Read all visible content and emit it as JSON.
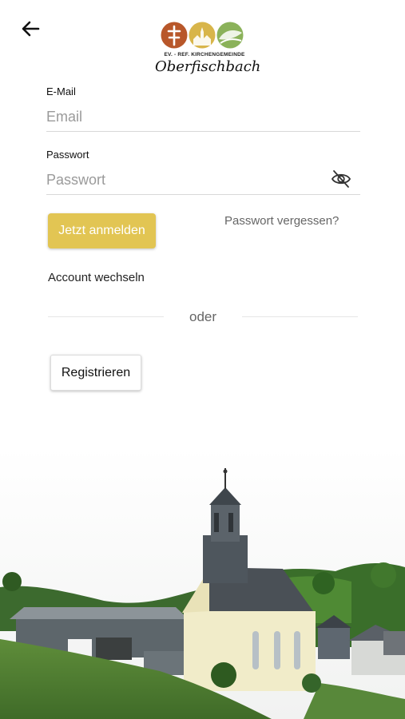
{
  "header": {
    "back_icon": "arrow-left-icon",
    "logo": {
      "subtitle": "EV. - REF. KIRCHENGEMEINDE",
      "name": "Oberfischbach",
      "colors": {
        "cross": "#b8572a",
        "church": "#d8b54a",
        "leaf": "#8bb25a"
      }
    }
  },
  "form": {
    "email": {
      "label": "E-Mail",
      "placeholder": "Email",
      "value": ""
    },
    "password": {
      "label": "Passwort",
      "placeholder": "Passwort",
      "value": "",
      "toggle_icon": "eye-off-icon"
    },
    "login_button": "Jetzt anmelden",
    "forgot_link": "Passwort vergessen?",
    "switch_account": "Account wechseln",
    "divider_text": "oder",
    "register_button": "Registrieren"
  },
  "colors": {
    "primary": "#e2c553",
    "text": "#222222",
    "muted": "#666666"
  },
  "hero_image": {
    "description_icon": "church-photo"
  }
}
